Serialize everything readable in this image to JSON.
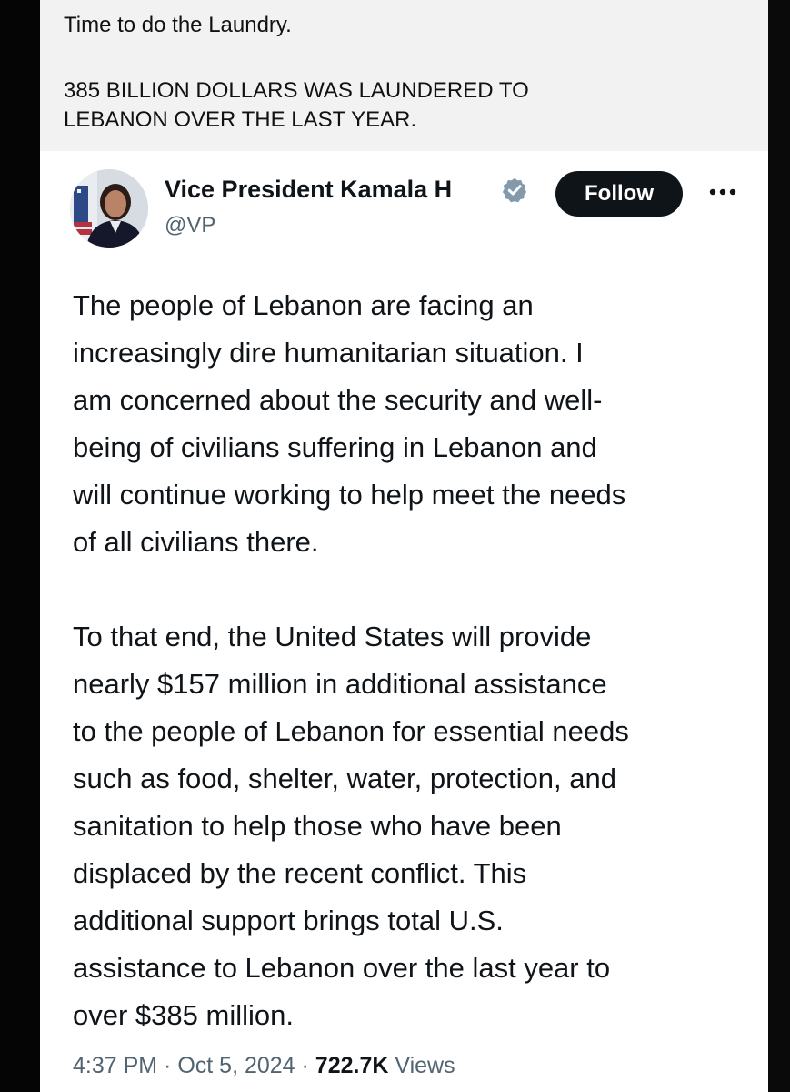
{
  "caption": {
    "line1": "Time to do the Laundry.",
    "line2": "385 BILLION DOLLARS WAS LAUNDERED TO",
    "line3": "LEBANON OVER THE LAST YEAR."
  },
  "tweet": {
    "author": {
      "display_name": "Vice President Kamala H",
      "handle": "@VP",
      "verified_icon": "verified-badge-icon"
    },
    "follow_label": "Follow",
    "more_icon": "more-options-icon",
    "paragraph1": "The people of Lebanon are facing an\nincreasingly dire humanitarian situation. I\nam concerned about the security and well-\nbeing of civilians suffering in Lebanon and\nwill continue working to help meet the needs\nof all civilians there.",
    "paragraph2": "To that end, the United States will provide\nnearly $157 million in additional assistance\nto the people of Lebanon for essential needs\nsuch as food, shelter, water, protection, and\nsanitation to help those who have been\ndisplaced by the recent conflict. This\nadditional support brings total U.S.\nassistance to Lebanon over the last year to\nover $385 million.",
    "meta": {
      "time": "4:37 PM",
      "separator": " · ",
      "date": "Oct 5, 2024",
      "views_count": "722.7K",
      "views_label": " Views"
    }
  },
  "colors": {
    "text_primary": "#0f1419",
    "text_secondary": "#536471",
    "verified": "#829aab",
    "caption_background": "#f2f2f2"
  }
}
